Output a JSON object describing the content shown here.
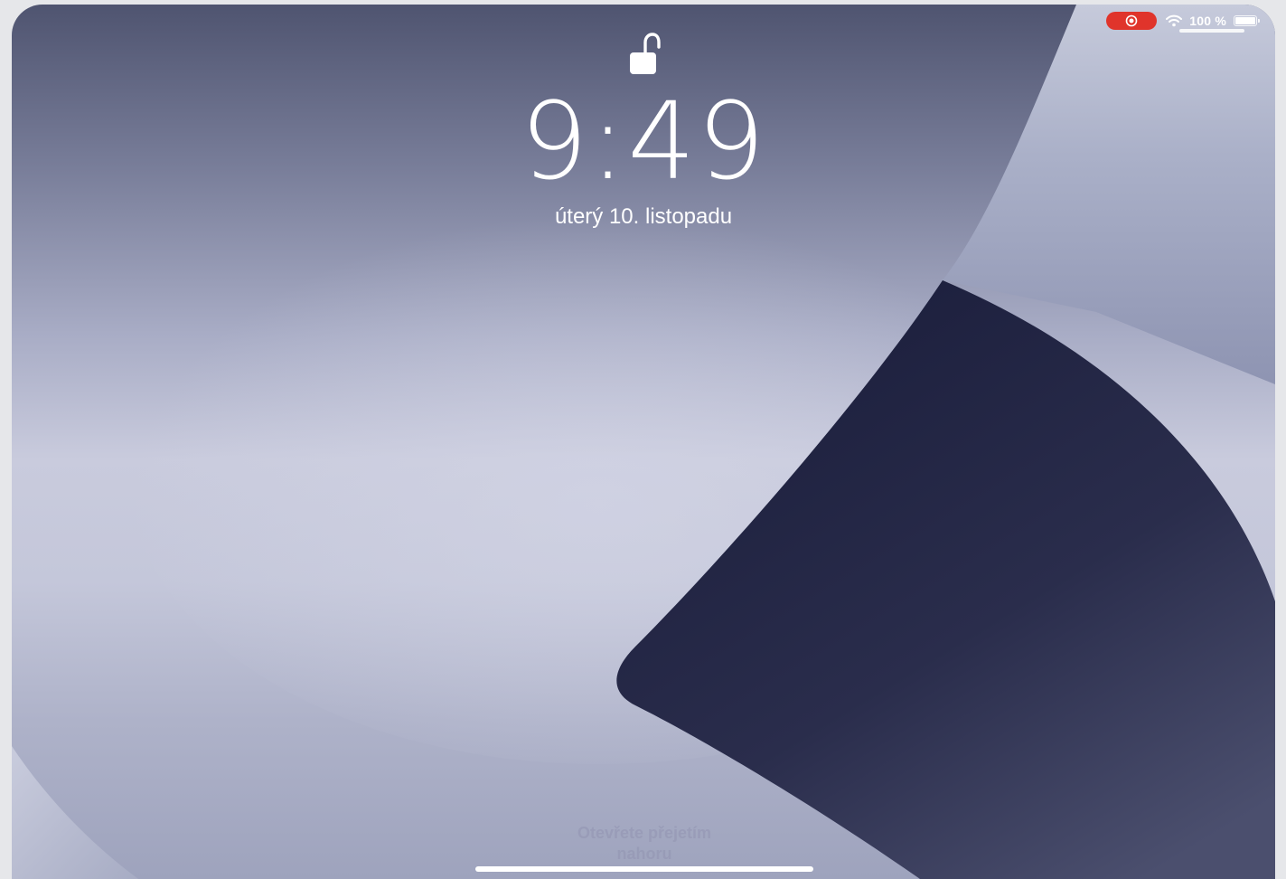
{
  "status_bar": {
    "recording_icon": "screen-recording-icon",
    "recording_color": "#e0342b",
    "wifi_icon": "wifi-icon",
    "battery_text": "100 %",
    "battery_icon": "battery-icon",
    "battery_level": 1.0
  },
  "lock_screen": {
    "lock_icon": "unlocked-padlock-icon",
    "time": "9:49",
    "date": "úterý 10. listopadu",
    "swipe_hint": "Otevřete přejetím nahoru"
  },
  "colors": {
    "wallpaper_light": "#c9cbdd",
    "wallpaper_dark": "#1f2240",
    "text": "#ffffff"
  }
}
